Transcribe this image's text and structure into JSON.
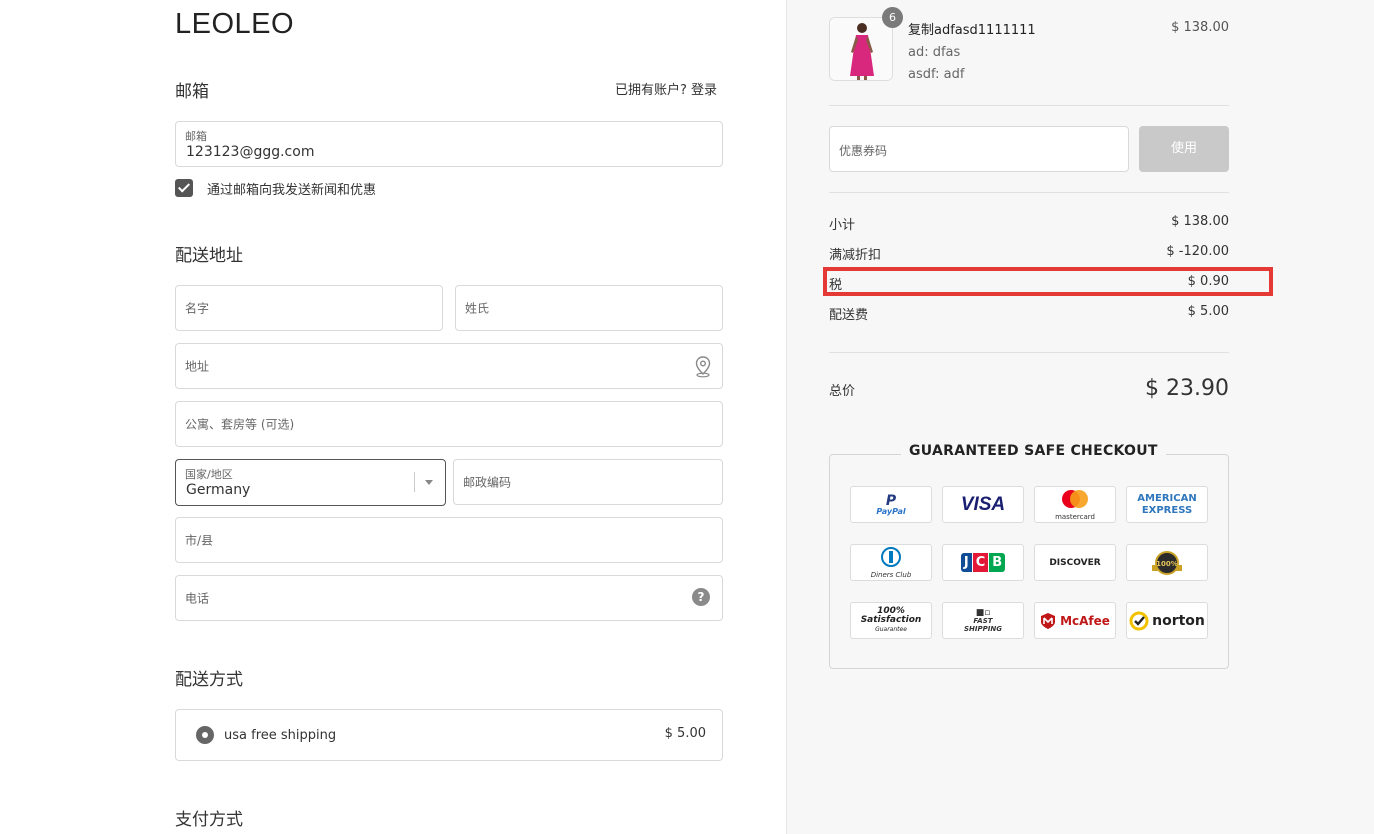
{
  "brand": "LEOLEO",
  "email_section": {
    "title": "邮箱",
    "login_prompt": "已拥有账户? 登录",
    "email_label": "邮箱",
    "email_value": "123123@ggg.com",
    "newsletter_label": "通过邮箱向我发送新闻和优惠"
  },
  "shipping_address": {
    "title": "配送地址",
    "first_name_placeholder": "名字",
    "last_name_placeholder": "姓氏",
    "address_placeholder": "地址",
    "apartment_placeholder": "公寓、套房等 (可选)",
    "country_label": "国家/地区",
    "country_value": "Germany",
    "postcode_placeholder": "邮政编码",
    "city_placeholder": "市/县",
    "phone_placeholder": "电话"
  },
  "shipping_method": {
    "title": "配送方式",
    "option_label": "usa free shipping",
    "option_price": "$ 5.00"
  },
  "payment": {
    "title": "支付方式"
  },
  "cart": {
    "quantity": "6",
    "product_name": "复制adfasd1111111",
    "variant_1": "ad: dfas",
    "variant_2": "asdf: adf",
    "price": "$ 138.00"
  },
  "coupon": {
    "placeholder": "优惠券码",
    "button": "使用"
  },
  "summary": {
    "subtotal_label": "小计",
    "subtotal_value": "$ 138.00",
    "discount_label": "满减折扣",
    "discount_value": "$ -120.00",
    "tax_label": "税",
    "tax_value": "$ 0.90",
    "shipping_label": "配送费",
    "shipping_value": "$ 5.00",
    "total_label": "总价",
    "total_value": "$ 23.90"
  },
  "trust": {
    "title": "GUARANTEED SAFE CHECKOUT",
    "paypal": "PayPal",
    "visa": "VISA",
    "mastercard": "mastercard",
    "amex_1": "AMERICAN",
    "amex_2": "EXPRESS",
    "diners": "Diners Club",
    "jcb": "JCB",
    "discover": "DISCOVER",
    "seal": "100%",
    "satisfaction_1": "100%",
    "satisfaction_2": "Satisfaction",
    "satisfaction_3": "Guarantee",
    "fast_1": "FAST",
    "fast_2": "SHIPPING",
    "mcafee": "McAfee",
    "norton": "norton"
  },
  "colors": {
    "highlight": "#e53935",
    "button_disabled": "#c9c9c9",
    "right_panel_bg": "#f7f7f7"
  }
}
